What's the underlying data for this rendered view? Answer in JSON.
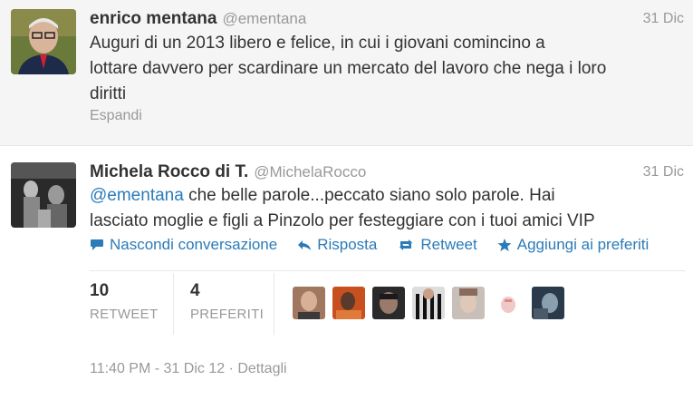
{
  "tweet1": {
    "fullname": "enrico mentana",
    "handle": "@ementana",
    "time": "31 Dic",
    "text_lines": [
      "Auguri di un 2013 libero e felice, in cui i giovani comincino a",
      "lottare davvero per scardinare un mercato del lavoro che nega i loro",
      "diritti"
    ],
    "expand_label": "Espandi"
  },
  "tweet2": {
    "fullname": "Michela Rocco di T.",
    "handle": "@MichelaRocco",
    "time": "31 Dic",
    "mention": "@ementana",
    "text_line1_rest": " che belle parole...peccato siano solo parole. Hai",
    "text_line2": "lasciato moglie e figli a Pinzolo per festeggiare con i tuoi amici VIP",
    "actions": {
      "hide_conversation": "Nascondi conversazione",
      "reply": "Risposta",
      "retweet": "Retweet",
      "favorite": "Aggiungi ai preferiti"
    },
    "stats": {
      "retweets_count": "10",
      "retweets_label": "RETWEET",
      "favorites_count": "4",
      "favorites_label": "PREFERITI"
    },
    "footer": {
      "timestamp": "11:40 PM - 31 Dic 12",
      "separator": " · ",
      "details": "Dettagli"
    }
  },
  "colors": {
    "link": "#2b7bb9",
    "muted": "#999999",
    "text": "#333333",
    "tweet1_bg": "#f5f5f5"
  }
}
